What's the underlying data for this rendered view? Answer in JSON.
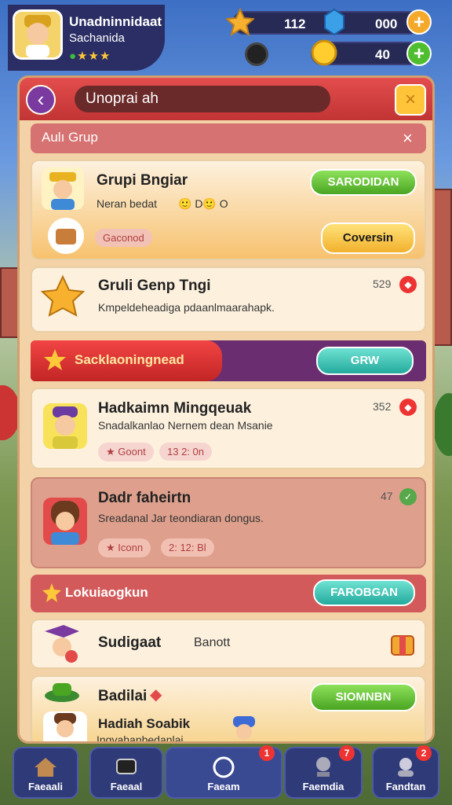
{
  "player": {
    "name": "Unadninnidaat",
    "subtitle": "Sachanida",
    "stars": "★★★"
  },
  "resources": [
    {
      "icon": "star-puzzle-icon",
      "value": "112"
    },
    {
      "icon": "blue-gem-icon",
      "value": "000"
    },
    {
      "icon": "coin-icon",
      "value": "40"
    }
  ],
  "header": {
    "search_text": "Unoprai ah",
    "close": "×",
    "back": "‹"
  },
  "subheader": {
    "label": "Aulı Grup",
    "close": "×"
  },
  "cards": {
    "c1": {
      "title": "Grupi Bngiar",
      "desc": "Neran bedat",
      "desc_extra": "🙂 D🙂 O",
      "tag": "Gaconod",
      "button": "SARODIDAN",
      "button2": "Coversin"
    },
    "c2": {
      "title": "Gruli Genp Tngi",
      "desc": "Kmpeldeheadiga pdaanlmaarahapk.",
      "count": "529"
    },
    "banner1": {
      "label": "Sacklaoningnead",
      "button": "GRW"
    },
    "c3": {
      "title": "Hadkaimn Mingqeuak",
      "desc": "Snadalkanlao Nernem dean Msanie",
      "count": "352",
      "tag": "Goont",
      "time": "13 2: 0n"
    },
    "c4": {
      "title": "Dadr faheirtn",
      "desc": "Sreadanal Jar teondiaran dongus.",
      "count": "47",
      "tag": "Iconn",
      "time": "2: 12: Bl"
    },
    "banner2": {
      "label": "Lokuiaogkun",
      "button": "FAROBGAN"
    },
    "c5": {
      "title": "Sudigaat",
      "sub": "Banott"
    },
    "c6": {
      "title": "Badilai",
      "title2": "Hadiah Soabik",
      "desc": "Ingvahanbedanlai",
      "button": "SIOMNBN"
    }
  },
  "nav": [
    {
      "label": "Faeaali",
      "badge": ""
    },
    {
      "label": "Faeaal",
      "badge": ""
    },
    {
      "label": "Faeam",
      "badge": "1"
    },
    {
      "label": "Faemdia",
      "badge": "7"
    },
    {
      "label": "Fandtan",
      "badge": "2"
    }
  ],
  "colors": {
    "panel": "#f3d2a7",
    "header_red": "#e34d4d",
    "accent_green": "#4aa522",
    "accent_yellow": "#f2b12c"
  }
}
